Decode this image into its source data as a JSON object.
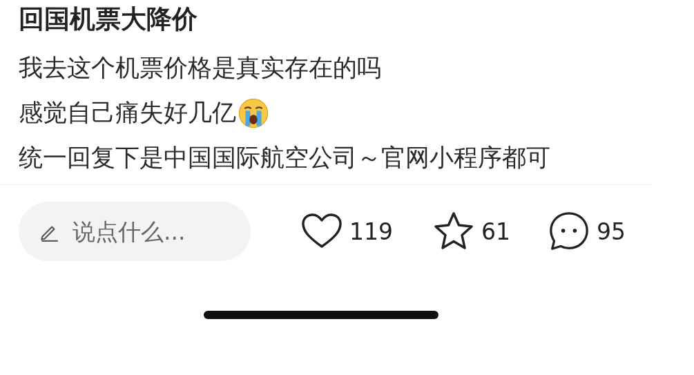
{
  "post": {
    "title": "回国机票大降价",
    "lines": [
      {
        "text": "我去这个机票价格是真实存在的吗",
        "emoji": false
      },
      {
        "text": "感觉自己痛失好几亿",
        "emoji": true
      },
      {
        "text": "统一回复下是中国国际航空公司～官网小程序都可",
        "emoji": false
      }
    ]
  },
  "actions": {
    "comment_field": {
      "placeholder": "说点什么..."
    },
    "buttons": [
      {
        "kind": "like",
        "count": "119"
      },
      {
        "kind": "collect",
        "count": "61"
      },
      {
        "kind": "comment",
        "count": "95"
      }
    ]
  }
}
